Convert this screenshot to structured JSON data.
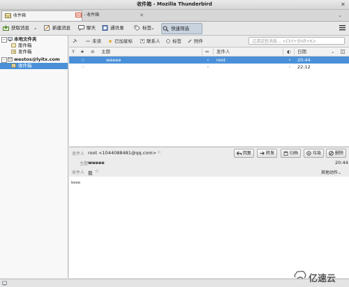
{
  "window": {
    "title": "收件箱 - Mozilla Thunderbird",
    "close_glyph": "✕"
  },
  "tabs": [
    {
      "label": "收件箱",
      "close": "✕",
      "active": true
    },
    {
      "label": "- 收件箱",
      "close": "✕",
      "active": false
    }
  ],
  "tab_overflow": "⌄",
  "toolbar": {
    "get_messages": "获取消息",
    "get_messages_arrow": "⌄",
    "new_message": "新建消息",
    "chat": "聊天",
    "address_book": "通讯录",
    "tag": "标签",
    "tag_arrow": "⌄",
    "quick_filter": "快速筛选",
    "menu_icon": "menu-icon"
  },
  "folders": {
    "local_folders": {
      "label": "本地文件夹",
      "twisty": "−"
    },
    "local_trash": "废件箱",
    "local_outbox": "发件箱",
    "account": {
      "label": "westos@lyitx.com",
      "twisty": "−"
    },
    "account_inbox": "收件箱"
  },
  "quick_filter": {
    "pin_icon": "pin-icon",
    "unread": "未读",
    "starred": "已加星标",
    "contacts": "联系人",
    "tags": "标签",
    "attachments": "附件",
    "search_placeholder": "过滤这些消息... <Ctrl+Shift+K>"
  },
  "thread_columns": {
    "thread": "Y",
    "star": "★",
    "attach": "⊘",
    "subject": "主题",
    "read": "⇔",
    "sender": "发件人",
    "junk": "◐",
    "date": "日期"
  },
  "messages": [
    {
      "subject": "weeee",
      "sender": "root",
      "date": "20:44",
      "selected": true
    },
    {
      "subject": "",
      "sender": "",
      "date": "22:12",
      "selected": false
    }
  ],
  "message_header": {
    "from_label": "发件人",
    "from_value": "root <1044088481@qq.com>",
    "subject_label": "主题",
    "subject_value": "weeee",
    "to_label": "收件人",
    "to_value": "我",
    "time": "20:44",
    "more_actions": "其他动作",
    "more_actions_arrow": "⌄",
    "reply": "回复",
    "forward": "转发",
    "archive": "归档",
    "junk": "垃圾",
    "delete": "删除"
  },
  "message_body": "beee",
  "watermark": "亿速云",
  "colors": {
    "selection": "#4a90d9",
    "quick_filter_active": "#c9d3df"
  }
}
